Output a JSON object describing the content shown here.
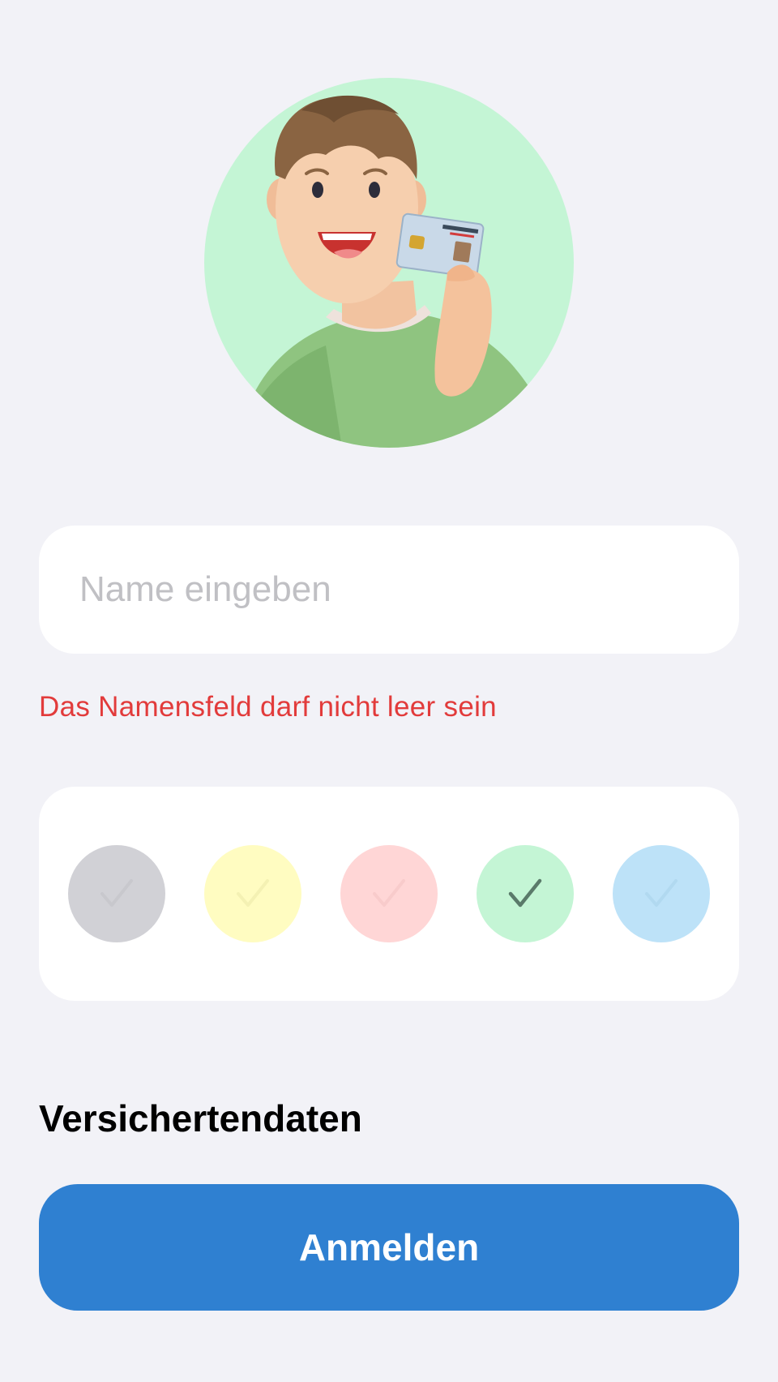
{
  "avatar": {
    "description_icon": "person-holding-id-card-illustration",
    "background_color": "#c4f5d5"
  },
  "name_field": {
    "value": "",
    "placeholder": "Name eingeben"
  },
  "error": {
    "message": "Das Namensfeld darf nicht leer sein",
    "color": "#e23b3b"
  },
  "color_picker": {
    "selected_index": 3,
    "swatches": [
      {
        "name": "gray",
        "color": "#d1d1d6",
        "selected": false
      },
      {
        "name": "yellow",
        "color": "#fffcc1",
        "selected": false
      },
      {
        "name": "red",
        "color": "#ffd6d6",
        "selected": false
      },
      {
        "name": "green",
        "color": "#c4f5d5",
        "selected": true
      },
      {
        "name": "blue",
        "color": "#bde2f8",
        "selected": false
      }
    ],
    "checkmark_icon": "checkmark-icon"
  },
  "section": {
    "title": "Versichertendaten"
  },
  "login_button": {
    "label": "Anmelden",
    "color": "#2f80d1"
  }
}
